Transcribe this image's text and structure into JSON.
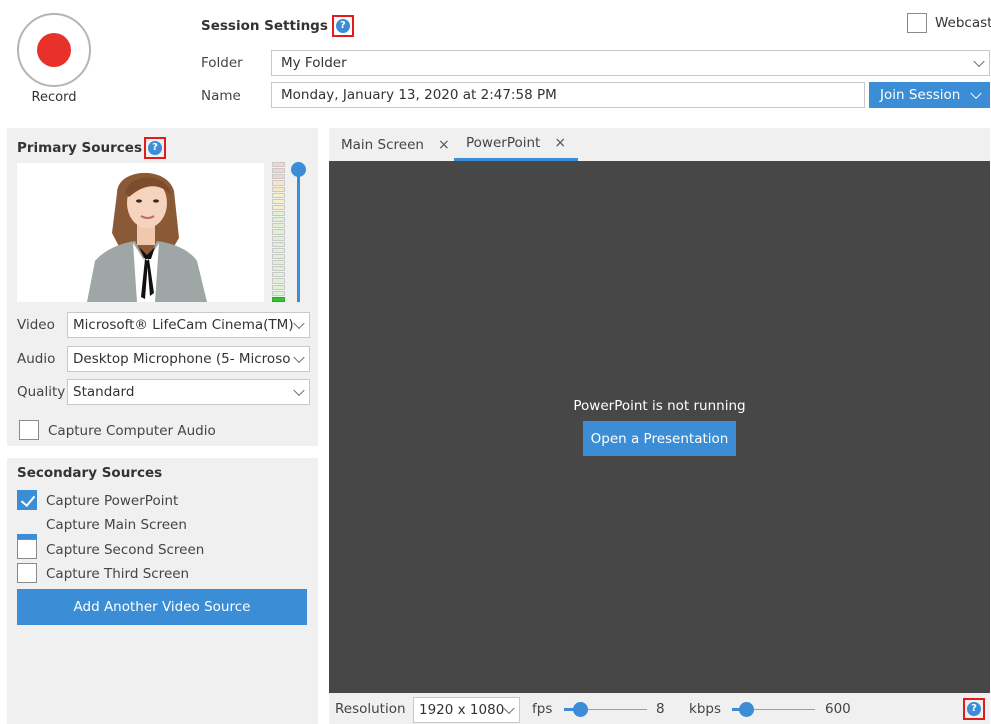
{
  "header": {
    "record_label": "Record",
    "session_title": "Session Settings",
    "help_glyph": "?",
    "webcast_label": "Webcast",
    "webcast_checked": false,
    "folder_label": "Folder",
    "folder_value": "My Folder",
    "name_label": "Name",
    "name_value": "Monday, January 13, 2020 at 2:47:58 PM",
    "join_label": "Join Session"
  },
  "primary": {
    "title": "Primary Sources",
    "video_label": "Video",
    "video_value": "Microsoft® LifeCam Cinema(TM)",
    "audio_label": "Audio",
    "audio_value": "Desktop Microphone (5- Microso",
    "quality_label": "Quality",
    "quality_value": "Standard",
    "capture_audio_label": "Capture Computer Audio",
    "capture_audio_checked": false
  },
  "secondary": {
    "title": "Secondary Sources",
    "items": [
      {
        "label": "Capture PowerPoint",
        "checked": true
      },
      {
        "label": "Capture Main Screen",
        "checked": true
      },
      {
        "label": "Capture Second Screen",
        "checked": false
      },
      {
        "label": "Capture Third Screen",
        "checked": false
      }
    ],
    "add_button": "Add Another Video Source"
  },
  "tabs": [
    {
      "label": "Main Screen",
      "close": "×",
      "active": false
    },
    {
      "label": "PowerPoint",
      "close": "×",
      "active": true
    }
  ],
  "viewer": {
    "message": "PowerPoint is not running",
    "open_button": "Open a Presentation"
  },
  "bottom": {
    "resolution_label": "Resolution",
    "resolution_value": "1920 x 1080",
    "fps_label": "fps",
    "fps_value": "8",
    "kbps_label": "kbps",
    "kbps_value": "600"
  },
  "colors": {
    "accent": "#3b8ed6",
    "record": "#e8312a",
    "highlight_box": "#e21c1c",
    "viewer_bg": "#474747"
  }
}
